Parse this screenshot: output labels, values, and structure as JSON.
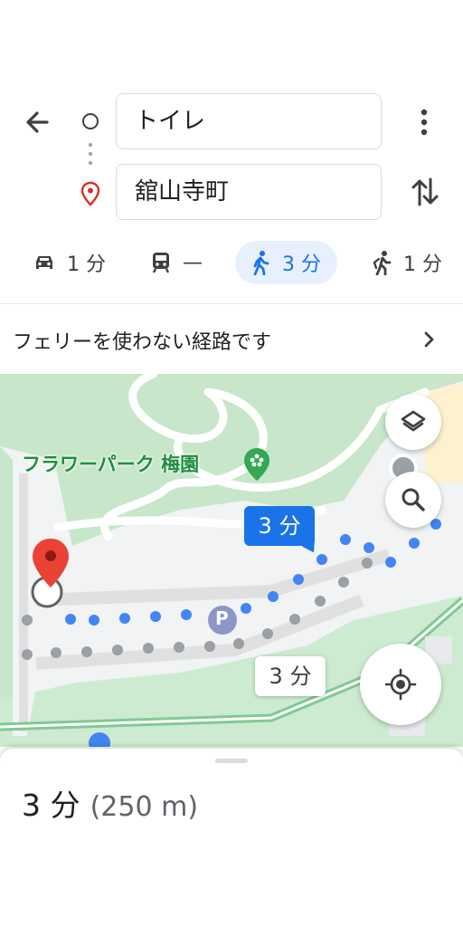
{
  "header": {
    "origin_value": "トイレ",
    "destination_value": "舘山寺町"
  },
  "modes": [
    {
      "icon": "car-icon",
      "label": "1 分",
      "selected": false
    },
    {
      "icon": "transit-icon",
      "label": "—",
      "selected": false
    },
    {
      "icon": "walk-icon",
      "label": "3 分",
      "selected": true
    },
    {
      "icon": "rideshare-icon",
      "label": "1 分",
      "selected": false
    }
  ],
  "notice": {
    "text": "フェリーを使わない経路です"
  },
  "map": {
    "park_label": "フラワーパーク 梅園",
    "route_time_selected": "3 分",
    "route_time_alt": "3 分",
    "parking_symbol": "P",
    "colors": {
      "selected_route": "#4285f4",
      "alt_route": "#9aa0a6",
      "park": "#c8e6c9",
      "pin": "#ea4335"
    }
  },
  "sheet": {
    "duration": "3 分",
    "distance": "(250 m)"
  }
}
